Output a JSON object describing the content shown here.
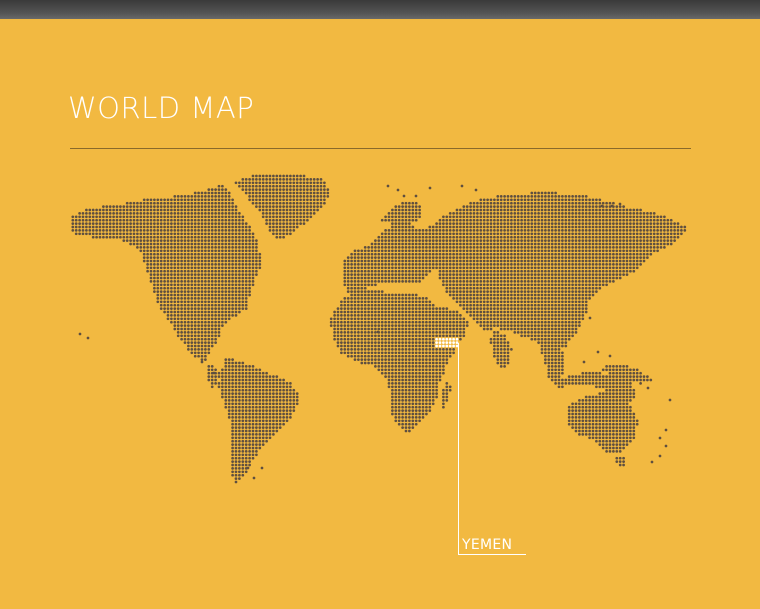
{
  "title": "WORLD MAP",
  "highlight": {
    "country": "YEMEN"
  },
  "colors": {
    "background": "#f2b941",
    "land_dots": "#5f4f3f",
    "highlight_dots": "#ffffff",
    "text": "#ffffff",
    "rule": "#8a6a2a"
  }
}
